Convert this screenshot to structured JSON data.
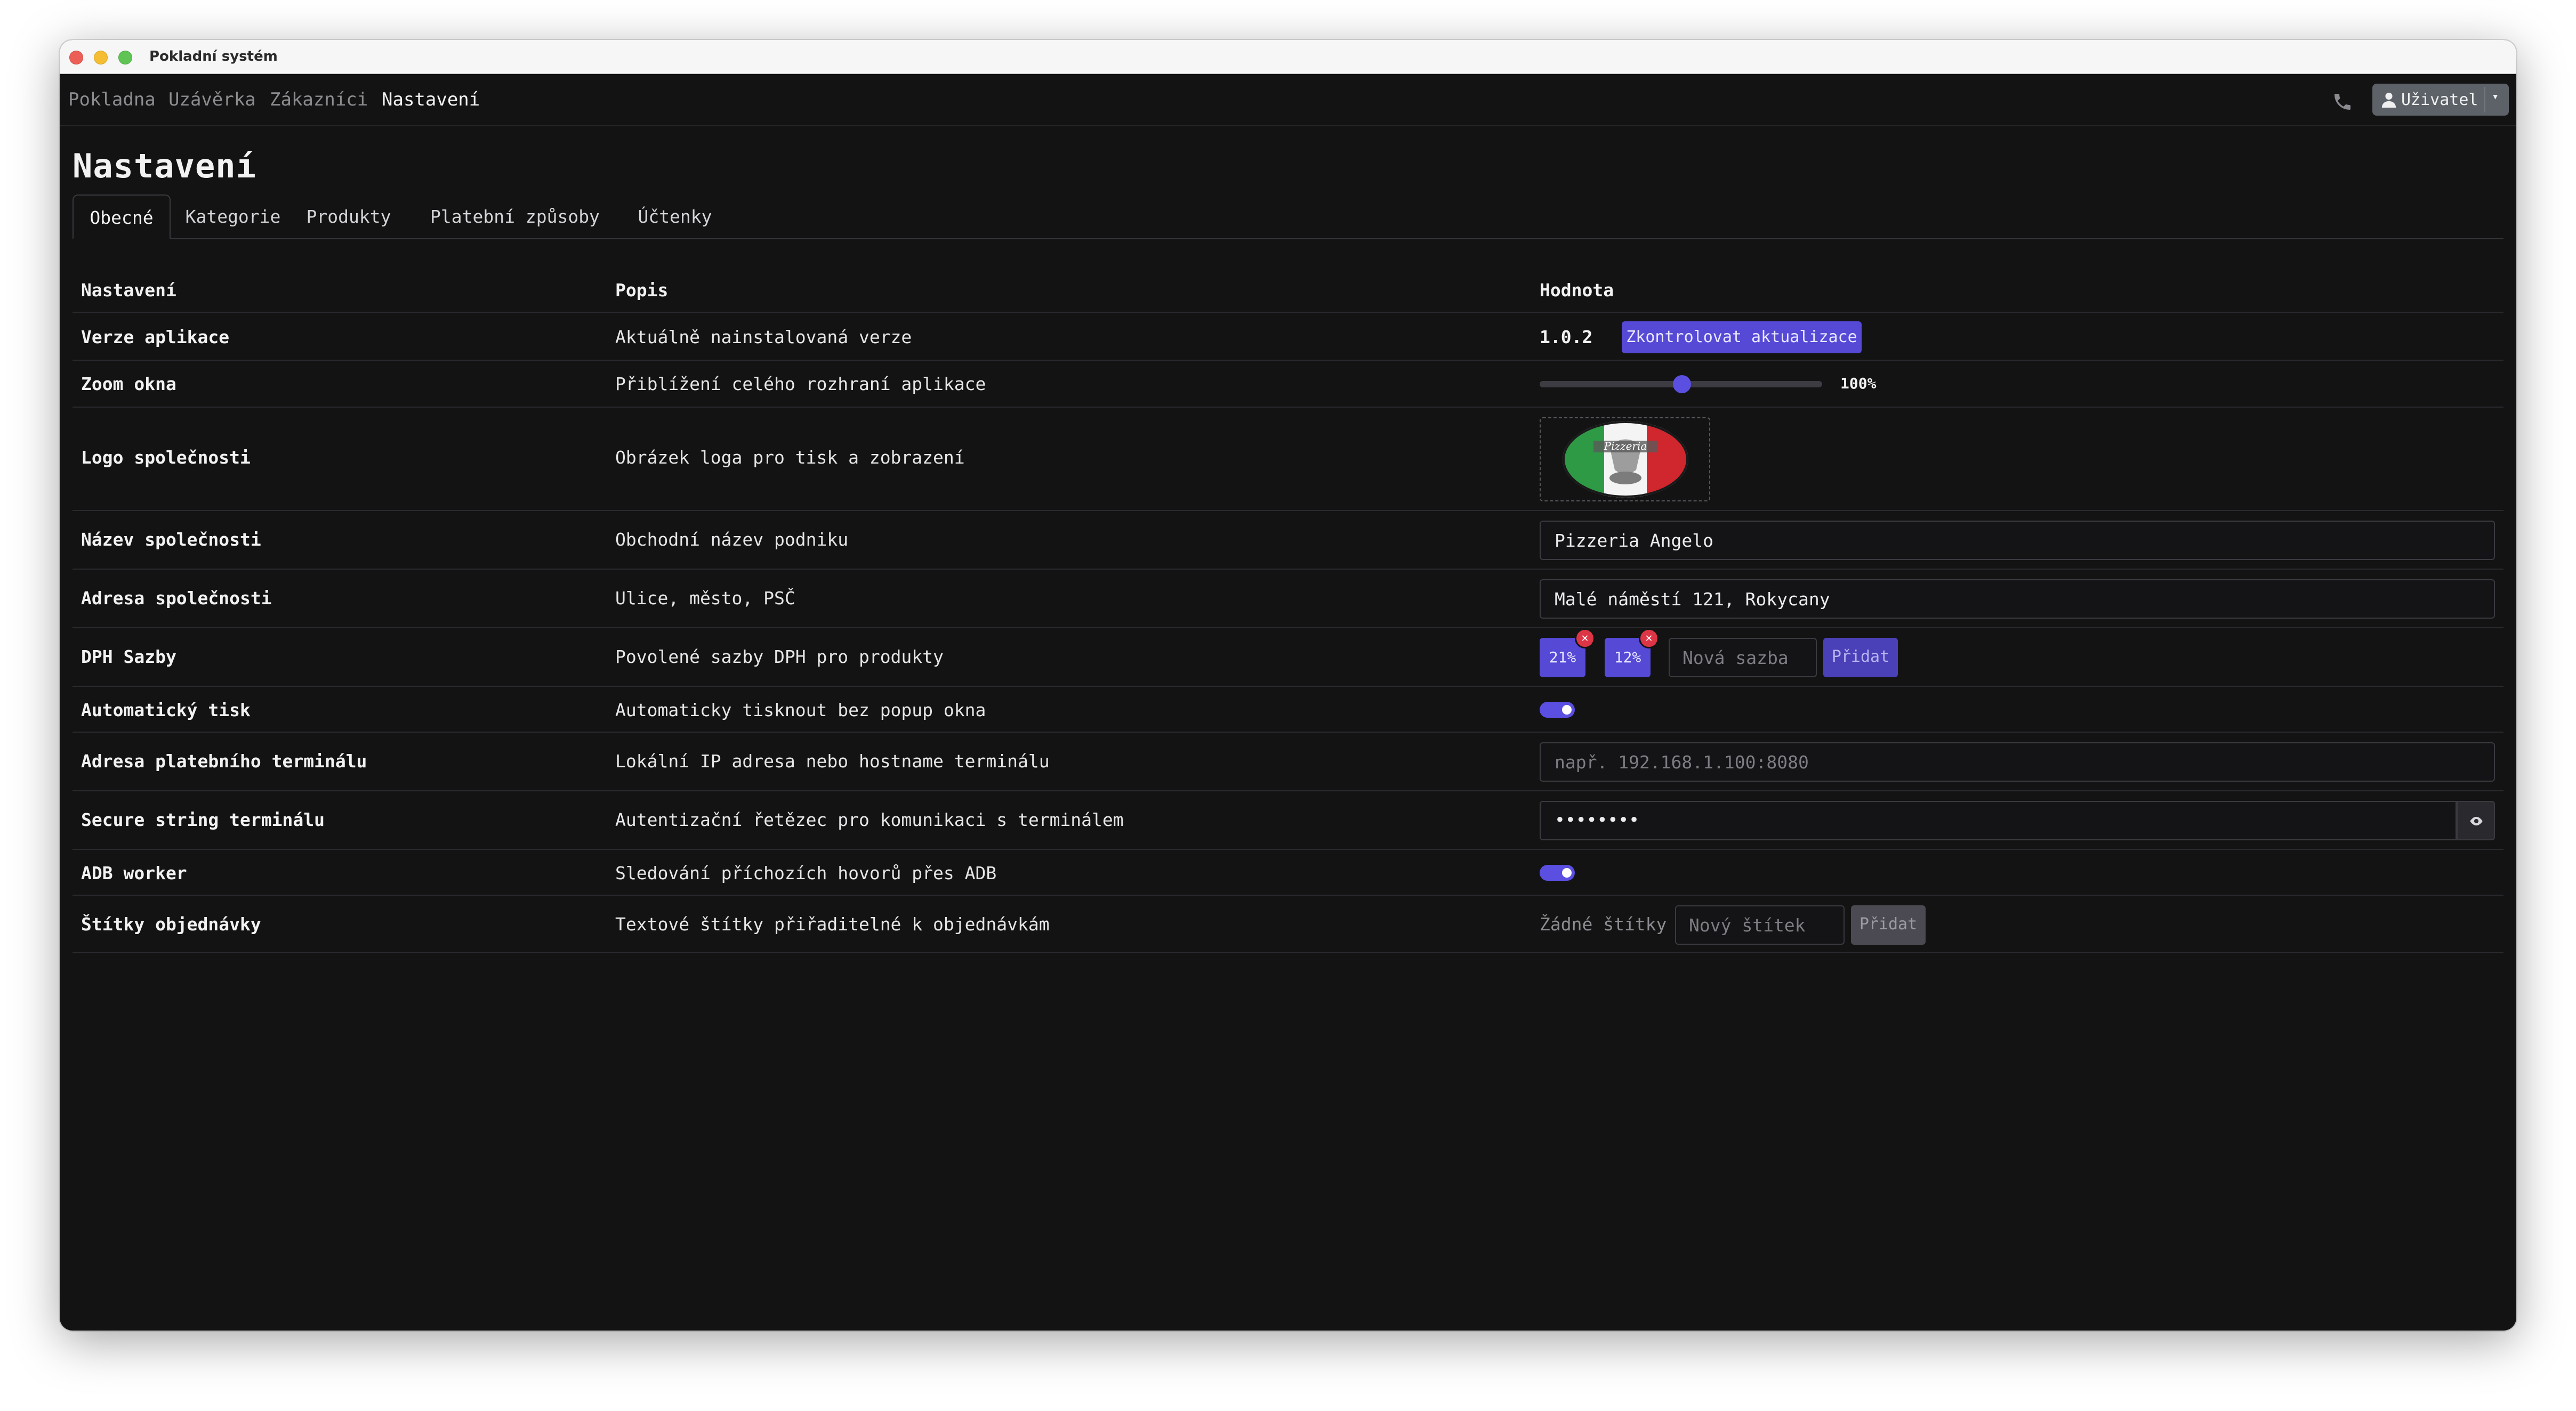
{
  "window": {
    "title": "Pokladní systém"
  },
  "nav": {
    "items": [
      "Pokladna",
      "Uzávěrka",
      "Zákazníci",
      "Nastavení"
    ],
    "active": "Nastavení",
    "user_label": "Uživatel"
  },
  "page": {
    "title": "Nastavení"
  },
  "tabs": [
    "Obecné",
    "Kategorie",
    "Produkty",
    "Platební způsoby",
    "Účtenky"
  ],
  "table": {
    "headers": [
      "Nastavení",
      "Popis",
      "Hodnota"
    ],
    "rows": [
      {
        "name": "Verze aplikace",
        "desc": "Aktuálně nainstalovaná verze",
        "version": "1.0.2",
        "button": "Zkontrolovat aktualizace"
      },
      {
        "name": "Zoom okna",
        "desc": "Přiblížení celého rozhraní aplikace",
        "zoom_value": "100%",
        "zoom_fraction": 0.5
      },
      {
        "name": "Logo společnosti",
        "desc": "Obrázek loga pro tisk a zobrazení",
        "logo_text": "Pizzeria"
      },
      {
        "name": "Název společnosti",
        "desc": "Obchodní název podniku",
        "value": "Pizzeria Angelo"
      },
      {
        "name": "Adresa společnosti",
        "desc": "Ulice, město, PSČ",
        "value": "Malé náměstí 121, Rokycany"
      },
      {
        "name": "DPH Sazby",
        "desc": "Povolené sazby DPH pro produkty",
        "rates": [
          "21%",
          "12%"
        ],
        "placeholder": "Nová sazba",
        "button": "Přidat"
      },
      {
        "name": "Automatický tisk",
        "desc": "Automaticky tisknout bez popup okna",
        "enabled": true
      },
      {
        "name": "Adresa platebního terminálu",
        "desc": "Lokální IP adresa nebo hostname terminálu",
        "placeholder": "např. 192.168.1.100:8080"
      },
      {
        "name": "Secure string terminálu",
        "desc": "Autentizační řetězec pro komunikaci s terminálem",
        "value": "••••••••"
      },
      {
        "name": "ADB worker",
        "desc": "Sledování příchozích hovorů přes ADB",
        "enabled": true
      },
      {
        "name": "Štítky objednávky",
        "desc": "Textové štítky přiřaditelné k objednávkám",
        "empty_text": "Žádné štítky",
        "placeholder": "Nový štítek",
        "button": "Přidat"
      }
    ]
  },
  "colors": {
    "background": "#131314",
    "accent": "#5549d6",
    "danger": "#dc3545"
  },
  "icons": [
    "phone-icon",
    "user-icon",
    "chevron-down-icon",
    "close-icon",
    "eye-icon"
  ]
}
